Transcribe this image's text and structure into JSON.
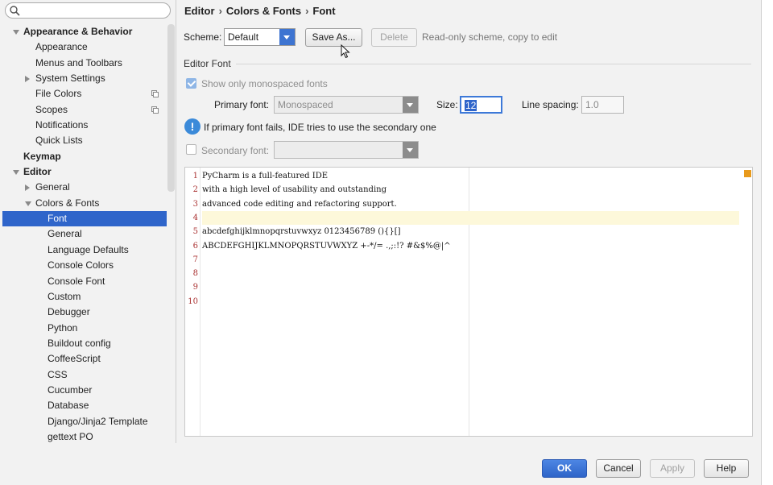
{
  "sidebar": {
    "search": {
      "placeholder": ""
    },
    "items": [
      {
        "label": "Appearance & Behavior",
        "level": 0,
        "bold": true,
        "expander": "down"
      },
      {
        "label": "Appearance",
        "level": 1
      },
      {
        "label": "Menus and Toolbars",
        "level": 1
      },
      {
        "label": "System Settings",
        "level": 1,
        "expander": "right"
      },
      {
        "label": "File Colors",
        "level": 1,
        "icon": "project-scope-icon"
      },
      {
        "label": "Scopes",
        "level": 1,
        "icon": "project-scope-icon"
      },
      {
        "label": "Notifications",
        "level": 1
      },
      {
        "label": "Quick Lists",
        "level": 1
      },
      {
        "label": "Keymap",
        "level": 0,
        "bold": true
      },
      {
        "label": "Editor",
        "level": 0,
        "bold": true,
        "expander": "down"
      },
      {
        "label": "General",
        "level": 1,
        "expander": "right"
      },
      {
        "label": "Colors & Fonts",
        "level": 1,
        "expander": "down"
      },
      {
        "label": "Font",
        "level": 2,
        "selected": true
      },
      {
        "label": "General",
        "level": 2
      },
      {
        "label": "Language Defaults",
        "level": 2
      },
      {
        "label": "Console Colors",
        "level": 2
      },
      {
        "label": "Console Font",
        "level": 2
      },
      {
        "label": "Custom",
        "level": 2
      },
      {
        "label": "Debugger",
        "level": 2
      },
      {
        "label": "Python",
        "level": 2
      },
      {
        "label": "Buildout config",
        "level": 2
      },
      {
        "label": "CoffeeScript",
        "level": 2
      },
      {
        "label": "CSS",
        "level": 2
      },
      {
        "label": "Cucumber",
        "level": 2
      },
      {
        "label": "Database",
        "level": 2
      },
      {
        "label": "Django/Jinja2 Template",
        "level": 2
      },
      {
        "label": "gettext PO",
        "level": 2
      }
    ]
  },
  "breadcrumb": {
    "part1": "Editor",
    "part2": "Colors & Fonts",
    "part3": "Font",
    "separator": "›"
  },
  "scheme": {
    "label": "Scheme:",
    "value": "Default",
    "save_as_label": "Save As...",
    "delete_label": "Delete",
    "hint": "Read-only scheme, copy to edit"
  },
  "editor_font": {
    "group_title": "Editor Font",
    "show_monospaced_label": "Show only monospaced fonts",
    "show_monospaced_checked": true,
    "primary_font_label": "Primary font:",
    "primary_font_value": "Monospaced",
    "size_label": "Size:",
    "size_value": "12",
    "line_spacing_label": "Line spacing:",
    "line_spacing_value": "1.0",
    "info_text": "If primary font fails, IDE tries to use the secondary one",
    "secondary_font_label": "Secondary font:",
    "secondary_font_value": "",
    "secondary_font_checked": false
  },
  "preview": {
    "lines": [
      {
        "num": "1",
        "text": "PyCharm is a full-featured IDE"
      },
      {
        "num": "2",
        "text": "with a high level of usability and outstanding"
      },
      {
        "num": "3",
        "text": "advanced code editing and refactoring support."
      },
      {
        "num": "4",
        "text": "",
        "current": true
      },
      {
        "num": "5",
        "text": "abcdefghijklmnopqrstuvwxyz 0123456789 (){}[]"
      },
      {
        "num": "6",
        "text": "ABCDEFGHIJKLMNOPQRSTUVWXYZ +-*/= .,;:!? #&$%@|^"
      },
      {
        "num": "7",
        "text": ""
      },
      {
        "num": "8",
        "text": ""
      },
      {
        "num": "9",
        "text": ""
      },
      {
        "num": "10",
        "text": ""
      }
    ]
  },
  "buttons": {
    "ok": "OK",
    "cancel": "Cancel",
    "apply": "Apply",
    "help": "Help"
  },
  "colors": {
    "accent": "#2f65ca",
    "selection": "#2f65ca",
    "current_line": "#fdf8da",
    "gutter_numbers": "#aa3333",
    "marker": "#e89a1c"
  }
}
